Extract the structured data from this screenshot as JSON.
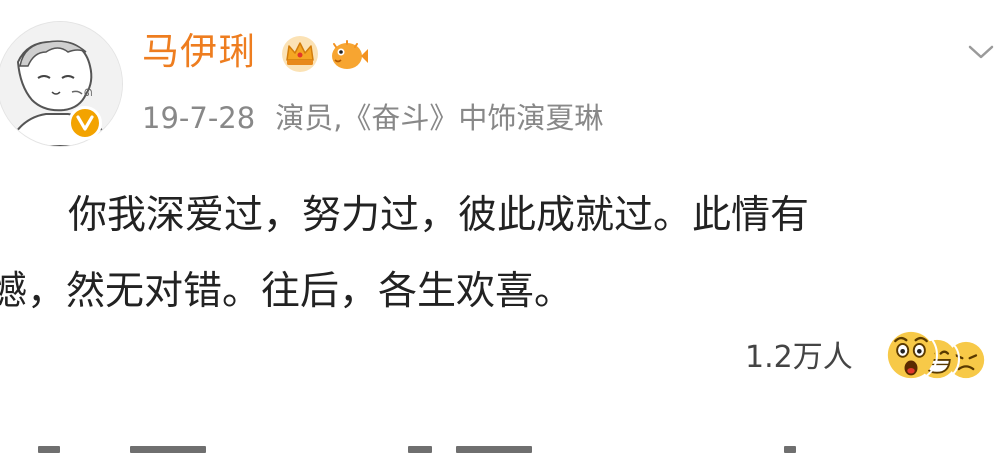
{
  "post": {
    "author": {
      "name": "马伊琍",
      "avatar_icon": "user-avatar-illustration",
      "verified_icon": "verified-v-badge-icon",
      "badges": [
        "crown-badge-icon",
        "pufferfish-badge-icon"
      ]
    },
    "meta": {
      "date": "19-7-28",
      "description": "演员,《奋斗》中饰演夏琳"
    },
    "content_lines": [
      "你我深爱过，努力过，彼此成就过。此情有",
      "憾，然无对错。往后，各生欢喜。"
    ],
    "likes": {
      "count": "1.2万人",
      "reaction_icons": [
        "surprised-emoji-icon",
        "laughing-emoji-icon",
        "angry-emoji-icon"
      ]
    }
  },
  "colors": {
    "username": "#ee7d1f",
    "meta_text": "#888888",
    "body_text": "#222222",
    "verified": "#f3a300"
  }
}
